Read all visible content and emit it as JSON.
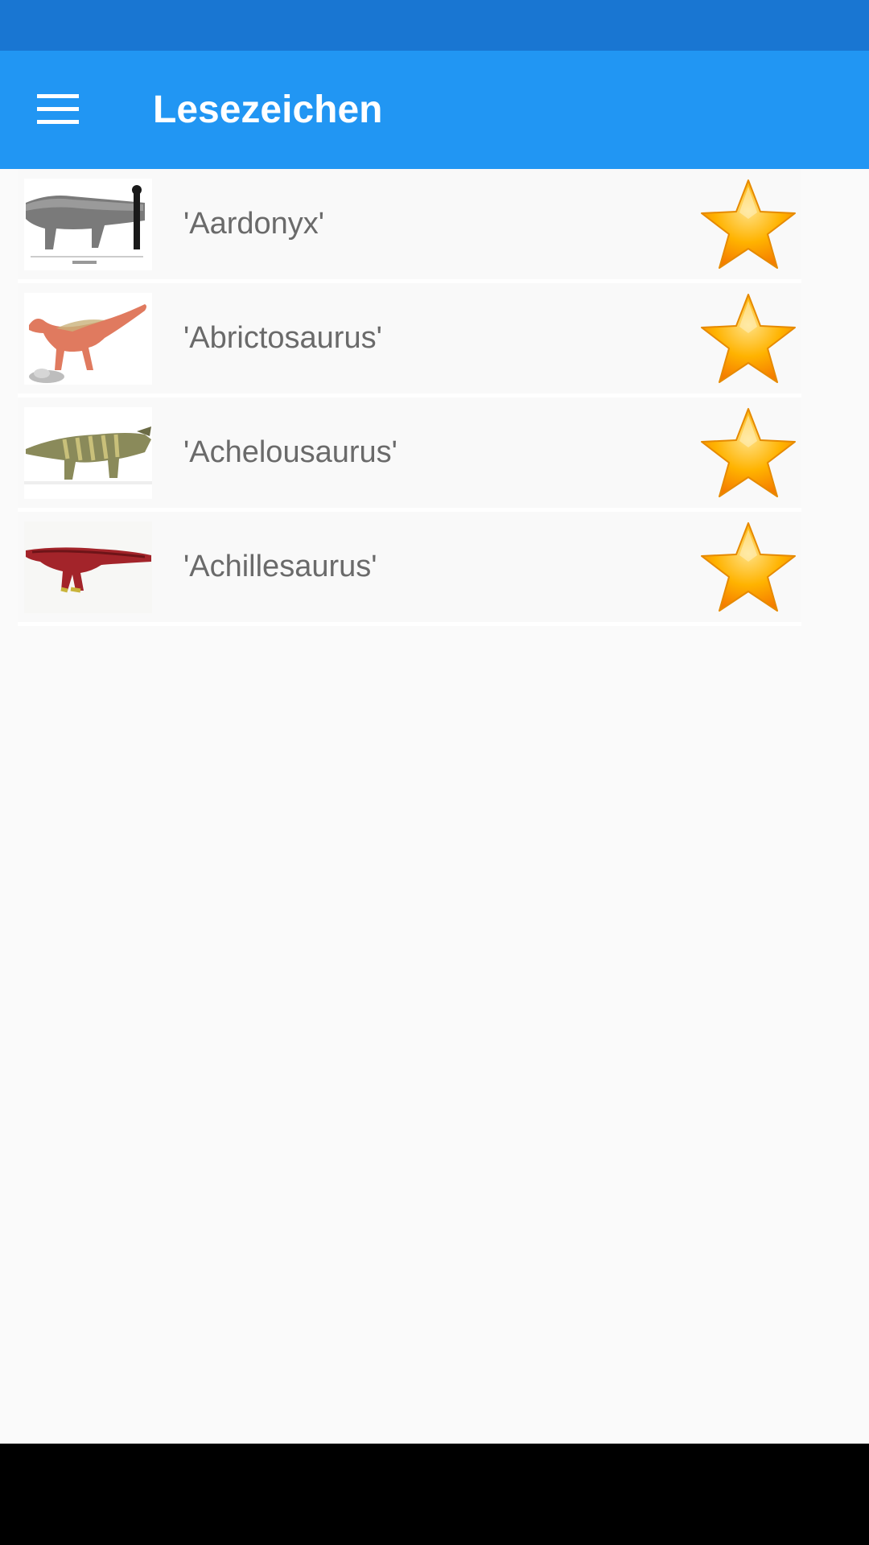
{
  "app_bar": {
    "title": "Lesezeichen",
    "menu_icon": "hamburger-menu-icon",
    "color": "#2196f3",
    "status_bar_color": "#1976d2"
  },
  "bookmarks": [
    {
      "name": "'Aardonyx'",
      "thumbnail": "aardonyx-image",
      "bookmark_icon": "star-icon",
      "bookmarked": true
    },
    {
      "name": "'Abrictosaurus'",
      "thumbnail": "abrictosaurus-image",
      "bookmark_icon": "star-icon",
      "bookmarked": true
    },
    {
      "name": "'Achelousaurus'",
      "thumbnail": "achelousaurus-image",
      "bookmark_icon": "star-icon",
      "bookmarked": true
    },
    {
      "name": "'Achillesaurus'",
      "thumbnail": "achillesaurus-image",
      "bookmark_icon": "star-icon",
      "bookmarked": true
    }
  ],
  "colors": {
    "star_fill": "#ffb300",
    "star_edge": "#f57c00",
    "background": "#fafafa"
  }
}
